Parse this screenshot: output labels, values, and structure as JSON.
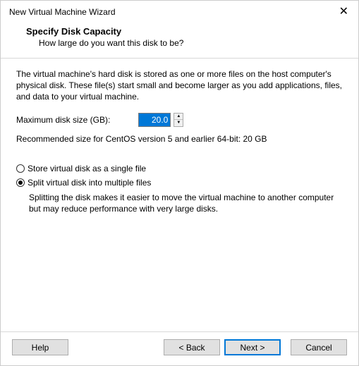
{
  "window": {
    "title": "New Virtual Machine Wizard"
  },
  "header": {
    "title": "Specify Disk Capacity",
    "subtitle": "How large do you want this disk to be?"
  },
  "body": {
    "description": "The virtual machine's hard disk is stored as one or more files on the host computer's physical disk. These file(s) start small and become larger as you add applications, files, and data to your virtual machine.",
    "size_label": "Maximum disk size (GB):",
    "size_value": "20.0",
    "recommendation": "Recommended size for CentOS version 5 and earlier 64-bit: 20 GB",
    "radio_single": "Store virtual disk as a single file",
    "radio_split": "Split virtual disk into multiple files",
    "split_desc": "Splitting the disk makes it easier to move the virtual machine to another computer but may reduce performance with very large disks."
  },
  "footer": {
    "help": "Help",
    "back": "< Back",
    "next": "Next >",
    "cancel": "Cancel"
  }
}
